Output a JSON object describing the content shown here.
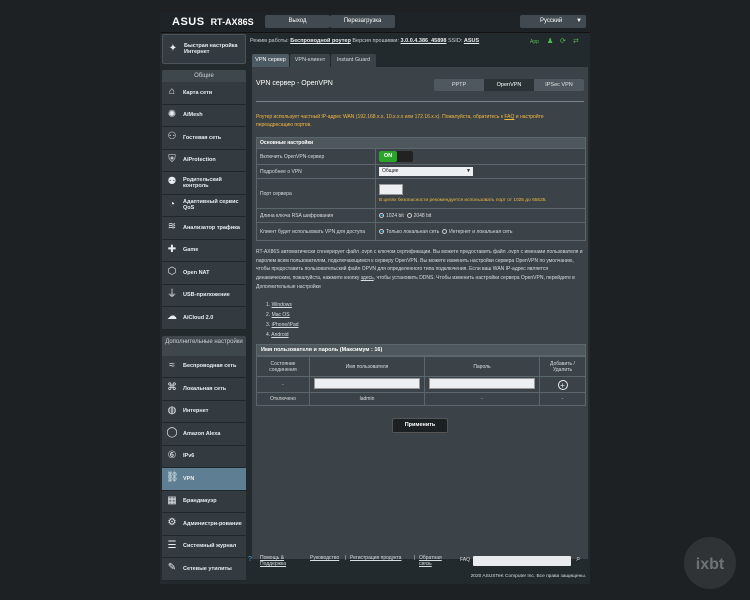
{
  "header": {
    "brand": "ASUS",
    "model": "RT-AX86S",
    "logout": "Выход",
    "reboot": "Перезагрузка",
    "language": "Русский"
  },
  "status": {
    "mode_label": "Режим работы:",
    "mode_value": "Беспроводной роутер",
    "fw_label": "Версия прошивки:",
    "fw_value": "3.0.0.4.386_45898",
    "ssid_label": "SSID:",
    "ssid_value": "ASUS",
    "app_label": "App"
  },
  "sidebar": {
    "quick_label": "Быстрая настройка Интернет",
    "section_general": "Общие",
    "general_items": [
      {
        "label": "Карта сети",
        "icon": "network-map-icon"
      },
      {
        "label": "AiMesh",
        "icon": "aimesh-icon"
      },
      {
        "label": "Гостевая сеть",
        "icon": "guest-network-icon"
      },
      {
        "label": "AiProtection",
        "icon": "shield-icon"
      },
      {
        "label": "Родительский контроль",
        "icon": "parental-control-icon"
      },
      {
        "label": "Адаптивный сервис QoS",
        "icon": "qos-icon"
      },
      {
        "label": "Анализатор трафика",
        "icon": "traffic-analyzer-icon"
      },
      {
        "label": "Game",
        "icon": "gamepad-icon"
      },
      {
        "label": "Open NAT",
        "icon": "open-nat-icon"
      },
      {
        "label": "USB-приложение",
        "icon": "usb-icon"
      },
      {
        "label": "AiCloud 2.0",
        "icon": "cloud-icon"
      }
    ],
    "section_advanced": "Дополнительные настройки",
    "advanced_items": [
      {
        "label": "Беспроводная сеть",
        "icon": "wifi-icon"
      },
      {
        "label": "Локальная сеть",
        "icon": "lan-icon"
      },
      {
        "label": "Интернет",
        "icon": "globe-icon"
      },
      {
        "label": "Amazon Alexa",
        "icon": "alexa-icon"
      },
      {
        "label": "IPv6",
        "icon": "ipv6-icon"
      },
      {
        "label": "VPN",
        "icon": "vpn-icon"
      },
      {
        "label": "Брандмауэр",
        "icon": "firewall-icon"
      },
      {
        "label": "Администри-рование",
        "icon": "admin-icon"
      },
      {
        "label": "Системный журнал",
        "icon": "log-icon"
      },
      {
        "label": "Сетевые утилиты",
        "icon": "tools-icon"
      }
    ],
    "active_item": "VPN"
  },
  "tabs": [
    "VPN сервер",
    "VPN-клиент",
    "Instant Guard"
  ],
  "main": {
    "title": "VPN сервер - OpenVPN",
    "segments": [
      "PPTP",
      "OpenVPN",
      "IPSec VPN"
    ],
    "active_segment": "OpenVPN",
    "note_a": "Роутер использует частный IP-адрес WAN (192.168.x.x, 10.x.x.x или 172.16.x.x). Пожалуйста, обратитесь к",
    "note_link": "FAQ",
    "note_b": "и настройте переадресацию портов.",
    "basic_title": "Основные настройки",
    "rows": {
      "enable_label": "Включить OpenVPN-сервер",
      "toggle_on": "ON",
      "details_label": "Подробнее о VPN",
      "details_value": "Общие",
      "port_label": "Порт сервера",
      "port_value": "",
      "port_warn": "В целях безопасности рекомендуется использовать порт от 1025 до 65535.",
      "rsa_label": "Длина ключа RSA шифрования",
      "rsa_opt1": "1024 bit",
      "rsa_opt2": "2048 bit",
      "client_label": "Клиент будет использовать VPN для доступа",
      "client_opt1": "Только локальная сеть",
      "client_opt2": "Интернет и локальная сеть"
    },
    "desc_a": "RT-AX86S автоматически сгенерирует файл .ovpn с ключом сертификации. Вы можете предоставить файл .ovpn с именами пользователя и паролем всем пользователям, подключающимся к серверу OpenVPN. Вы можете изменить настройки сервера OpenVPN по умолчанию, чтобы предоставить пользовательский файл OPVN для определенного типа подключения. Если ваш WAN IP-адрес является динамическим, пожалуйста, нажмите кнопку",
    "desc_link": "здесь",
    "desc_b": ", чтобы установить DDNS. Чтобы изменить настройки сервера OpenVPN, перейдите в Дополнительные настройки",
    "os_list": [
      "Windows",
      "Mac OS",
      "iPhone/iPad",
      "Android"
    ],
    "users_title": "Имя пользователя и пароль (Максимум : 16)",
    "users_headers": {
      "status": "Состояние соединения",
      "username": "Имя пользователя",
      "password": "Пароль",
      "add": "Добавить / Удалить"
    },
    "input_row_status": "-",
    "user_rows": [
      {
        "status": "Отключено",
        "username": "ladmin",
        "password": "-",
        "action": "-"
      }
    ],
    "apply": "Применить"
  },
  "footer": {
    "help": "Помощь & Поддержка",
    "manual": "Руководство",
    "register": "Регистрация продукта",
    "feedback": "Обратная связь",
    "faq": "FAQ",
    "copyright": "2020 ASUSTeK Computer Inc. Все права защищены."
  },
  "watermark": "ixbt"
}
